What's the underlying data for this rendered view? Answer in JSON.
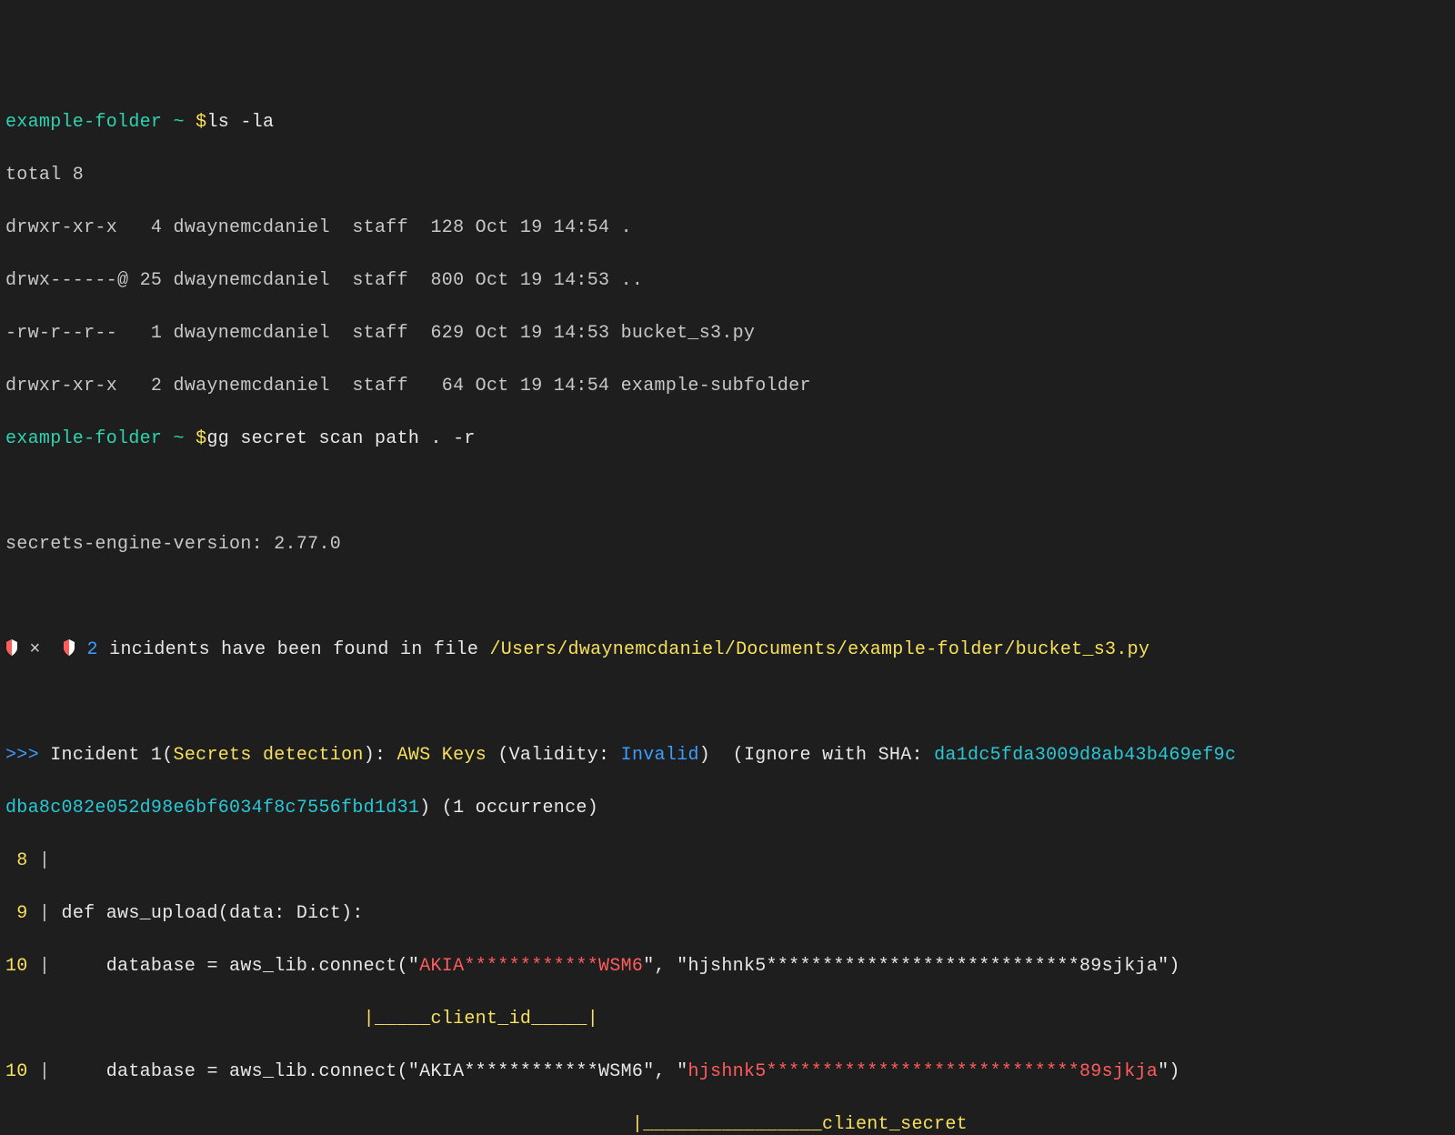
{
  "prompt1": {
    "folder": "example-folder",
    "tilde": " ~ ",
    "dollar": "$",
    "cmd": "ls -la"
  },
  "ls": {
    "total": "total 8",
    "r1": "drwxr-xr-x   4 dwaynemcdaniel  staff  128 Oct 19 14:54 .",
    "r2": "drwx------@ 25 dwaynemcdaniel  staff  800 Oct 19 14:53 ..",
    "r3": "-rw-r--r--   1 dwaynemcdaniel  staff  629 Oct 19 14:53 bucket_s3.py",
    "r4": "drwxr-xr-x   2 dwaynemcdaniel  staff   64 Oct 19 14:54 example-subfolder"
  },
  "prompt2": {
    "folder": "example-folder",
    "tilde": " ~ ",
    "dollar": "$",
    "cmd": "gg secret scan path . -r"
  },
  "engine": "secrets-engine-version: 2.77.0",
  "header": {
    "count": "2",
    "msg": " incidents have been found in file ",
    "path": "/Users/dwaynemcdaniel/Documents/example-folder/bucket_s3.py"
  },
  "incident": {
    "prefix": ">>> ",
    "label": "Incident 1(",
    "detect": "Secrets detection",
    "close1": "): ",
    "kind": "AWS Keys",
    "val_open": " (Validity: ",
    "validity": "Invalid",
    "val_close": ")  (Ignore with SHA: ",
    "sha_a": "da1dc5fda3009d8ab43b469ef9c",
    "sha_b": "dba8c082e052d98e6bf6034f8c7556fbd1d31",
    "tail": ") (1 occurrence)"
  },
  "code": {
    "l8": {
      "num": " 8",
      "bar": " | "
    },
    "l9": {
      "num": " 9",
      "bar": " | ",
      "txt": "def aws_upload(data: Dict):"
    },
    "l10a": {
      "num": "10",
      "bar": " | ",
      "pre": "    database = aws_lib.connect(\"",
      "key": "AKIA************WSM6",
      "mid": "\", \"hjshnk5****************************89sjkja\")"
    },
    "ann1": "                                |_____client_id_____|",
    "l10b": {
      "num": "10",
      "bar": " | ",
      "pre": "    database = aws_lib.connect(\"AKIA************WSM6\", \"",
      "sec": "hjshnk5****************************89sjkja",
      "post": "\")"
    },
    "ann2": "                                                        |________________client_secret"
  },
  "icons": {
    "x": "×"
  }
}
